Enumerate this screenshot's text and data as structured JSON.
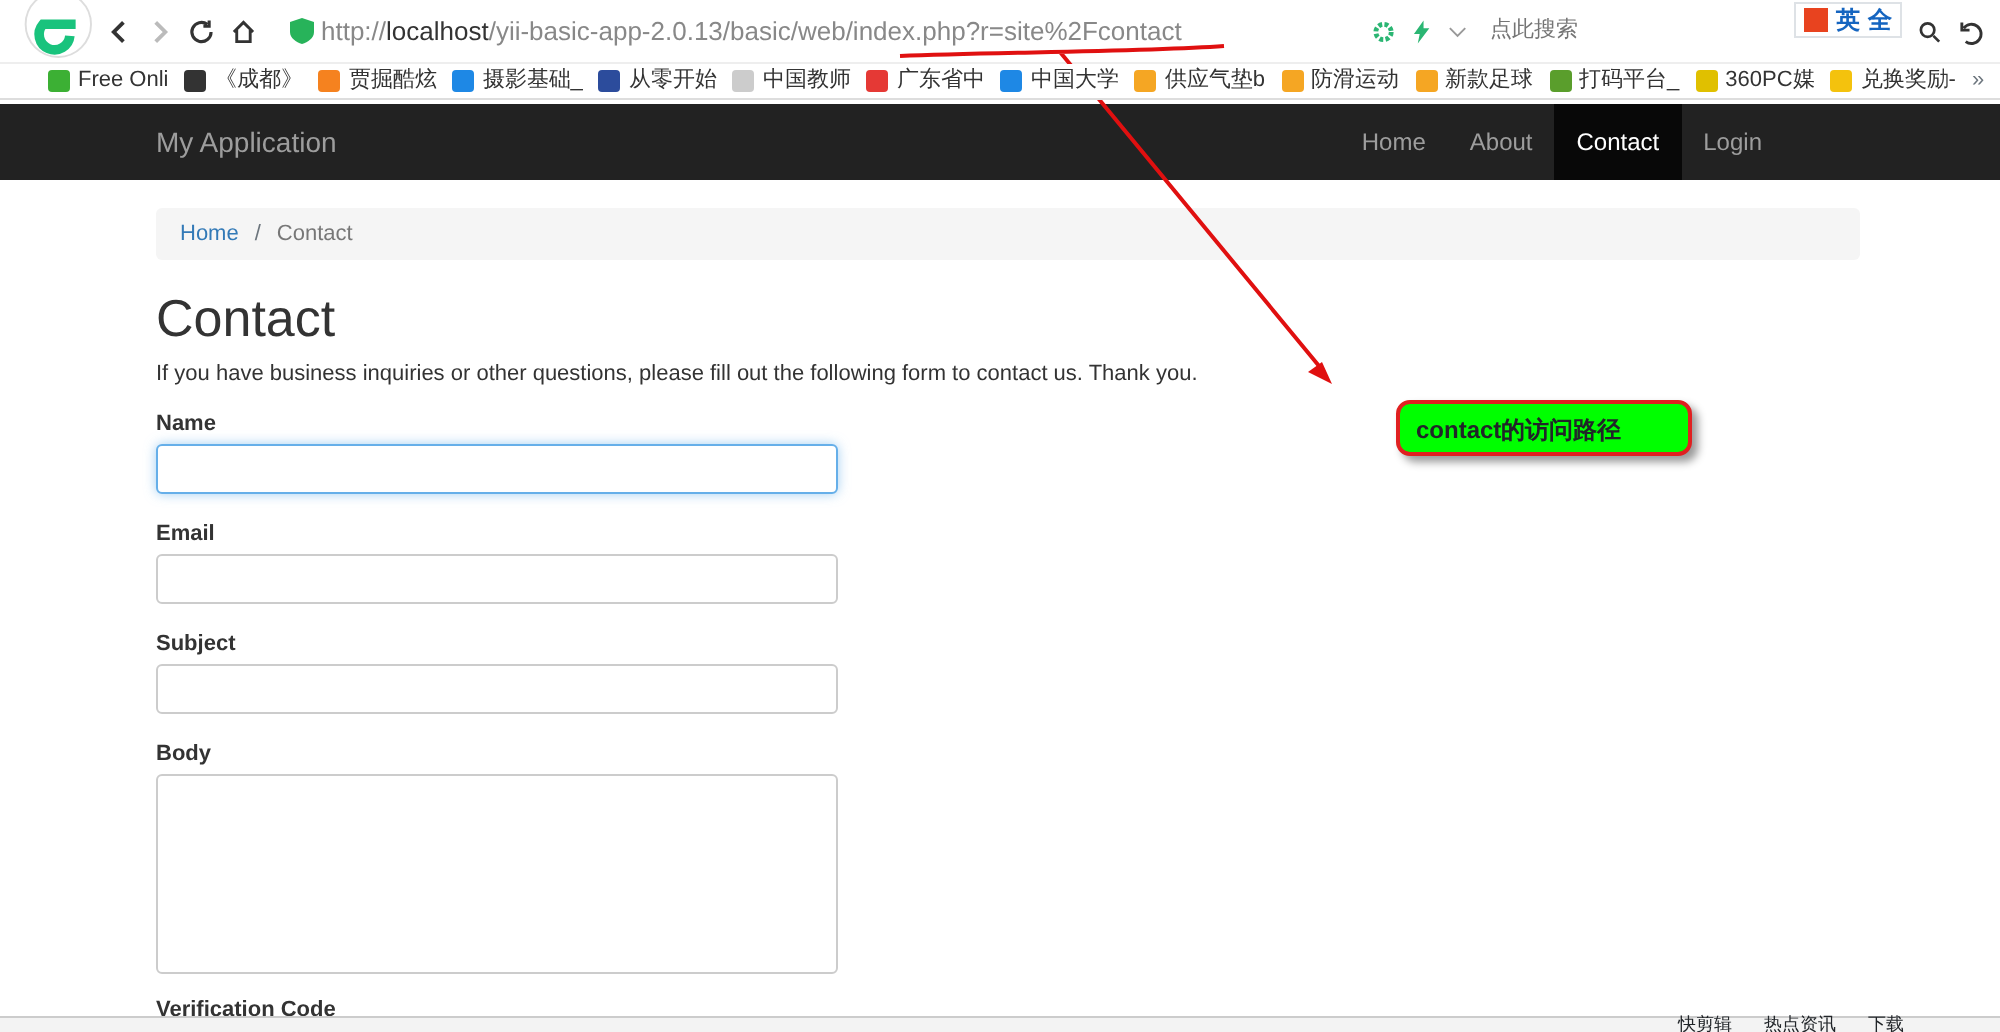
{
  "browser": {
    "url_host": "http://",
    "url_bold": "localhost",
    "url_rest": "/yii-basic-app-2.0.13/basic/web/index.php?r=site%2Fcontact",
    "search_placeholder": "点此搜索",
    "ime": [
      "英",
      "全"
    ]
  },
  "bookmarks": [
    "Free Onli",
    "《成都》",
    "贾掘酷炫",
    "摄影基础_",
    "从零开始",
    "中国教师",
    "广东省中",
    "中国大学",
    "供应气垫b",
    "防滑运动",
    "新款足球",
    "打码平台_",
    "360PC媒",
    "兑换奖励-"
  ],
  "more": "»",
  "navbar": {
    "brand": "My Application",
    "items": [
      {
        "label": "Home",
        "selected": false
      },
      {
        "label": "About",
        "selected": false
      },
      {
        "label": "Contact",
        "selected": true
      },
      {
        "label": "Login",
        "selected": false
      }
    ]
  },
  "breadcrumb_separator": "/",
  "breadcrumb": [
    {
      "label": "Home",
      "selected": false
    },
    {
      "label": "Contact",
      "selected": true
    }
  ],
  "heading": "Contact",
  "intro": "If you have business inquiries or other questions, please fill out the following form to contact us. Thank you.",
  "fields": [
    {
      "label": "Name",
      "kind": "input",
      "focused": true
    },
    {
      "label": "Email",
      "kind": "input",
      "focused": false
    },
    {
      "label": "Subject",
      "kind": "input",
      "focused": false
    },
    {
      "label": "Body",
      "kind": "textarea",
      "focused": false
    },
    {
      "label": "Verification Code",
      "kind": "cut"
    }
  ],
  "callout": "contact的访问路径",
  "status_bar": [
    "快剪辑",
    "热点资讯",
    "下载"
  ]
}
